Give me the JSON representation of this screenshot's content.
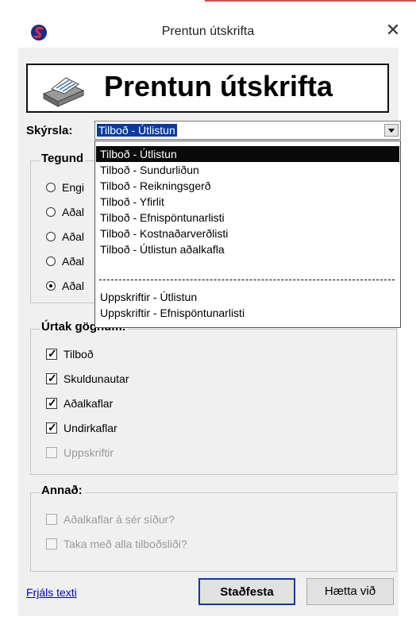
{
  "window": {
    "title": "Prentun útskrifta",
    "close_glyph": "✕",
    "app_icon": "app-logo-icon"
  },
  "banner": {
    "title": "Prentun útskrifta",
    "icon": "printer-icon"
  },
  "report": {
    "label": "Skýrsla:",
    "selected": "Tilboð - Útlistun"
  },
  "dropdown": {
    "items": [
      "Tilboð - Útlistun",
      "Tilboð - Sundurliðun",
      "Tilboð - Reikningsgerð",
      "Tilboð - Yfirlit",
      "Tilboð - Efnispöntunarlisti",
      "Tilboð - Kostnaðarverðlisti",
      "Tilboð - Útlistun aðalkafla",
      "Uppskriftir - Útlistun",
      "Uppskriftir - Efnispöntunarlisti"
    ]
  },
  "type_group": {
    "title": "Tegund",
    "options": [
      "Engi",
      "Aðal",
      "Aðal",
      "Aðal",
      "Aðal"
    ],
    "selected_index": 4
  },
  "data_group": {
    "title": "Úrtak gögnum:",
    "checks": [
      {
        "label": "Tilboð",
        "checked": true,
        "enabled": true
      },
      {
        "label": "Skuldunautar",
        "checked": true,
        "enabled": true
      },
      {
        "label": "Aðalkaflar",
        "checked": true,
        "enabled": true
      },
      {
        "label": "Undirkaflar",
        "checked": true,
        "enabled": true
      },
      {
        "label": "Uppskriftir",
        "checked": false,
        "enabled": false
      }
    ]
  },
  "other_group": {
    "title": "Annað:",
    "checks": [
      {
        "label": "Aðalkaflar á sér síður?",
        "checked": false,
        "enabled": false
      },
      {
        "label": "Taka með alla tilboðsliði?",
        "checked": false,
        "enabled": false
      }
    ]
  },
  "footer": {
    "link": "Frjáls texti",
    "confirm": "Staðfesta",
    "cancel": "Hætta við"
  },
  "colors": {
    "accent": "#0a3aa0",
    "dialog_bg": "#f0f0f0",
    "link": "#0000cc"
  }
}
